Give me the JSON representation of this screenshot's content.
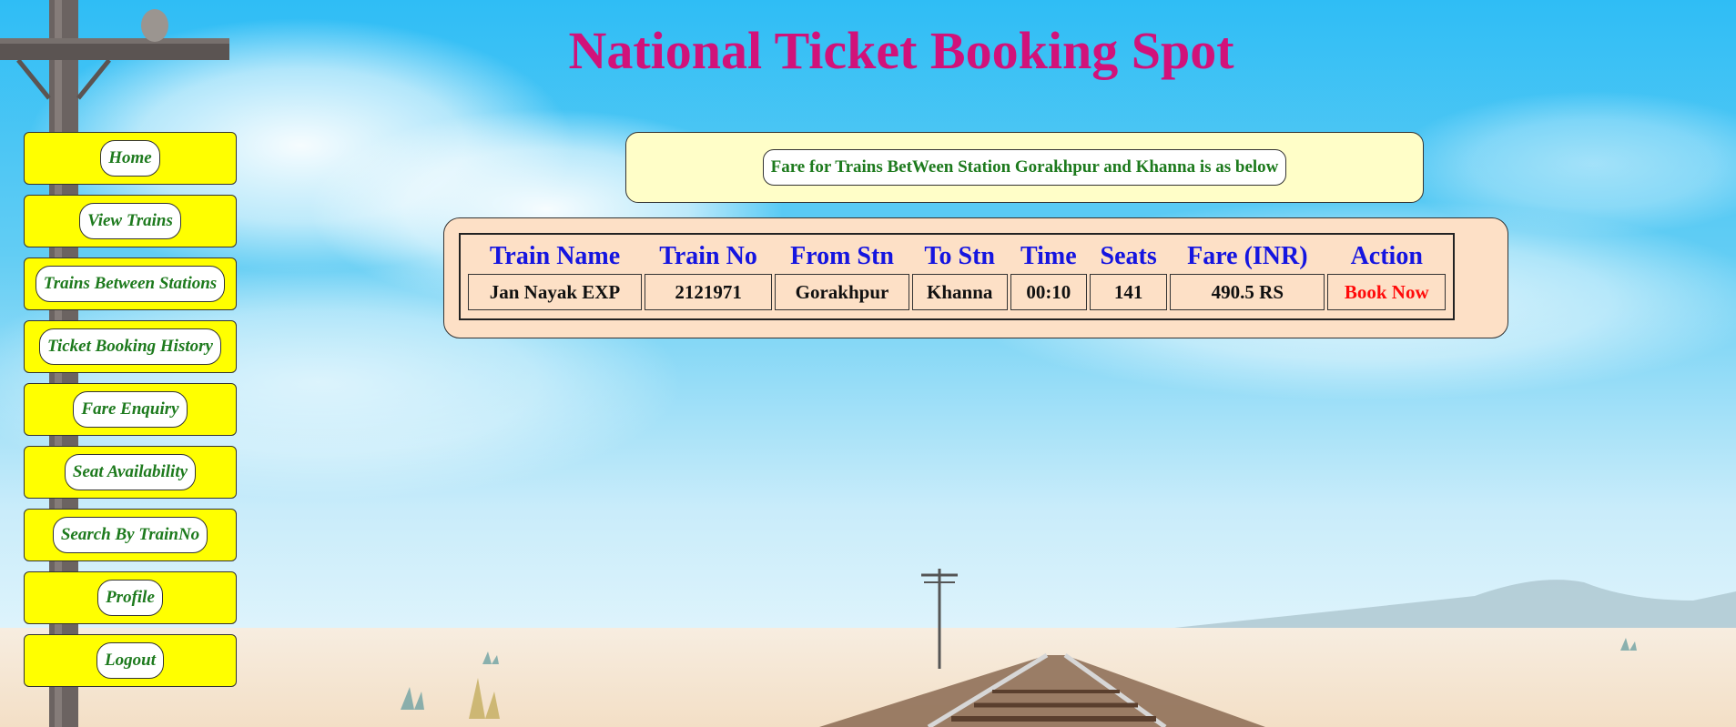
{
  "header": {
    "title": "National Ticket Booking Spot"
  },
  "sidebar": {
    "items": [
      {
        "label": "Home"
      },
      {
        "label": "View Trains"
      },
      {
        "label": "Trains Between Stations"
      },
      {
        "label": "Ticket Booking History"
      },
      {
        "label": "Fare Enquiry"
      },
      {
        "label": "Seat Availability"
      },
      {
        "label": "Search By TrainNo"
      },
      {
        "label": "Profile"
      },
      {
        "label": "Logout"
      }
    ]
  },
  "notice": {
    "text": "Fare for Trains BetWeen Station Gorakhpur and Khanna is as below"
  },
  "table": {
    "headers": [
      "Train Name",
      "Train No",
      "From Stn",
      "To Stn",
      "Time",
      "Seats",
      "Fare (INR)",
      "Action"
    ],
    "rows": [
      {
        "train_name": "Jan Nayak EXP",
        "train_no": "2121971",
        "from_stn": "Gorakhpur",
        "to_stn": "Khanna",
        "time": "00:10",
        "seats": "141",
        "fare": "490.5 RS",
        "action": "Book Now"
      }
    ]
  },
  "colors": {
    "title": "#d1127a",
    "menu_bg": "#ffff00",
    "menu_text": "#1d7a1d",
    "notice_bg": "#fffec8",
    "table_panel_bg": "#fde0c6",
    "table_header": "#1515e0",
    "action_link": "#ff0a0a",
    "sky": "#2fbdf5"
  }
}
